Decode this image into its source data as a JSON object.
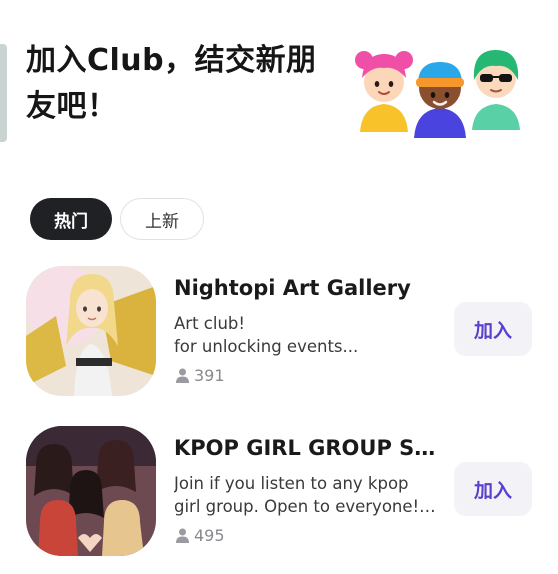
{
  "header": {
    "title": "加入Club，结交新朋友吧！"
  },
  "tabs": [
    {
      "label": "热门",
      "active": true
    },
    {
      "label": "上新",
      "active": false
    }
  ],
  "clubs": [
    {
      "name": "Nightopi Art Gallery",
      "desc_line1": "Art club!",
      "desc_line2": "for unlocking events...",
      "members": "391",
      "join_label": "加入"
    },
    {
      "name": " KPOP GIRL GROUP ST...",
      "desc_line1": "Join if you listen to any kpop",
      "desc_line2": "girl group. Open to everyone! ...",
      "members": "495",
      "join_label": "加入"
    }
  ],
  "icons": {
    "member": "person-icon",
    "avatars": [
      "pink-hair-avatar-icon",
      "orange-beanie-avatar-icon",
      "green-hair-sunglasses-avatar-icon"
    ]
  },
  "colors": {
    "accent": "#5b3fd0",
    "active_tab_bg": "#1f2124"
  }
}
